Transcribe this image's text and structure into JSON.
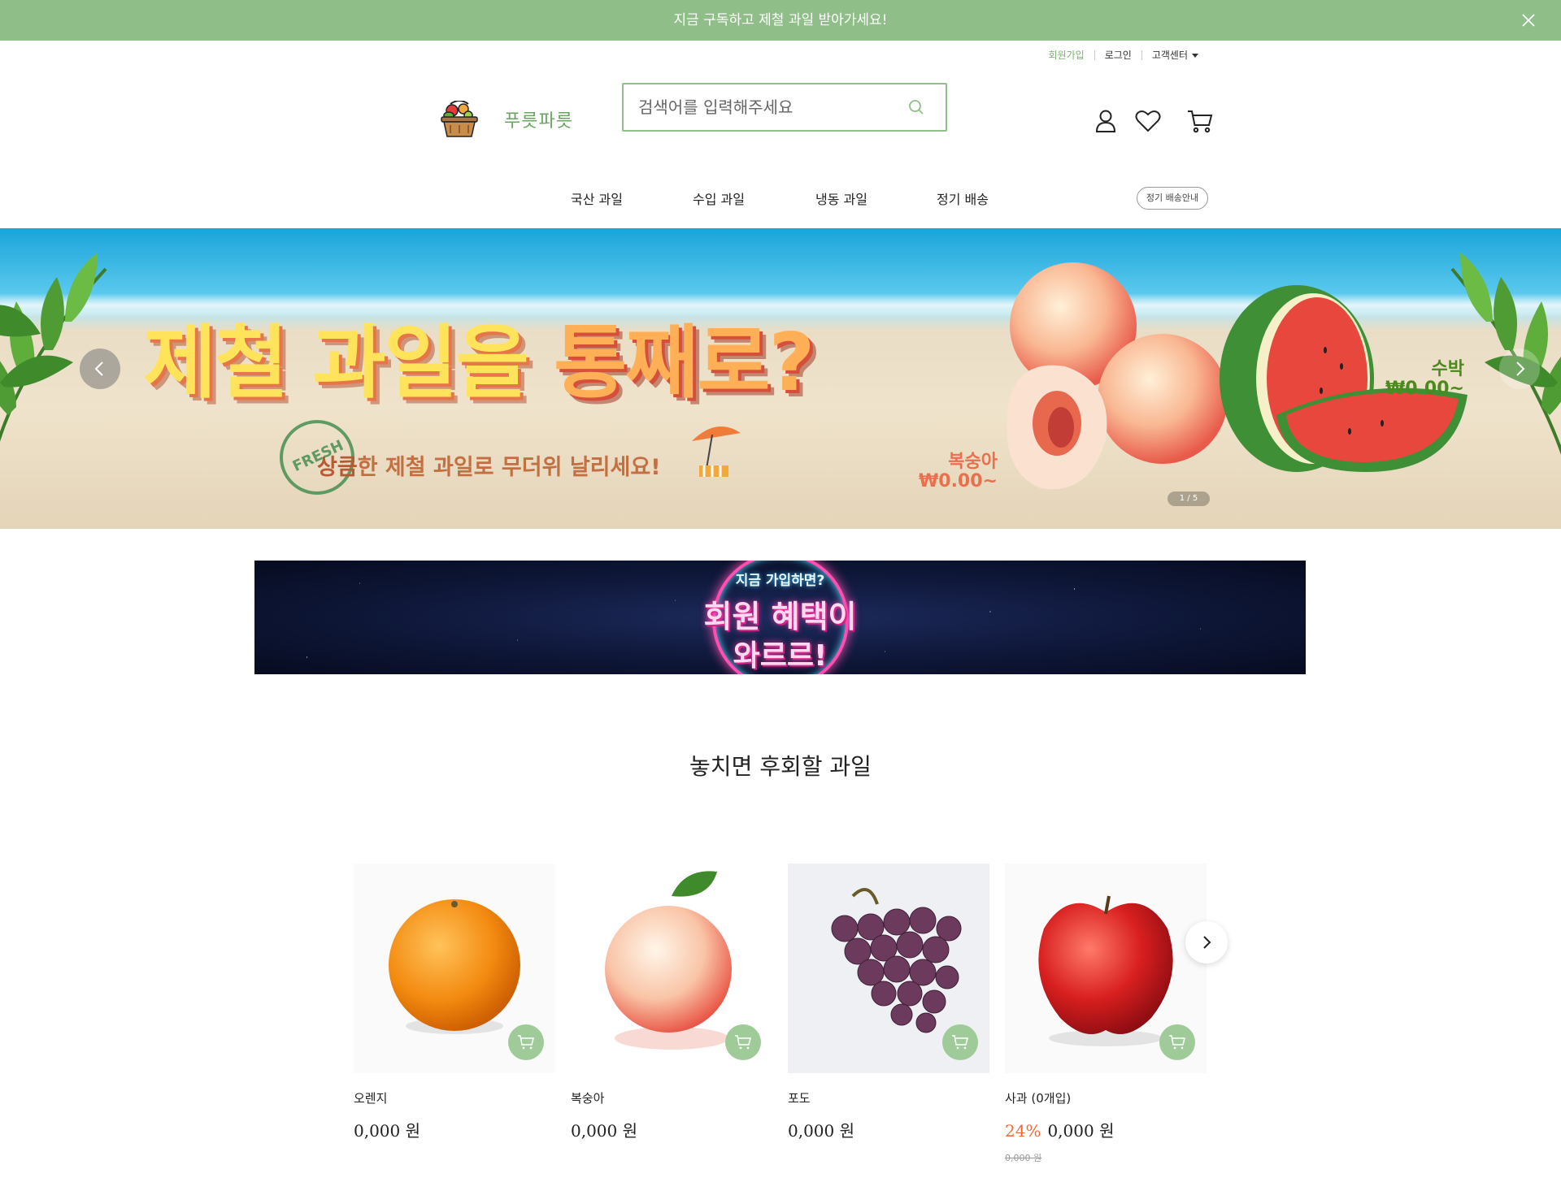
{
  "announcement": {
    "text": "지금 구독하고 제철 과일 받아가세요!"
  },
  "util_links": {
    "signup": "회원가입",
    "login": "로그인",
    "support": "고객센터"
  },
  "brand": {
    "name": "푸릇파릇"
  },
  "search": {
    "placeholder": "검색어를 입력해주세요"
  },
  "header_icons": [
    "user-icon",
    "heart-icon",
    "cart-icon"
  ],
  "nav": {
    "items": [
      "국산 과일",
      "수입 과일",
      "냉동 과일",
      "정기 배송"
    ],
    "pill": "정기 배송안내"
  },
  "hero": {
    "title_a": "제철 과일을 ",
    "title_b": "통째로?",
    "sub_a": "상큼",
    "sub_b": "한 제철 과일로 무더위 날리세요!",
    "stamp": "FRESH",
    "peach_name": "복숭아",
    "peach_price": "₩0.00~",
    "melon_name": "수박",
    "melon_price": "₩0.00~",
    "pager": "1 / 5"
  },
  "promo": {
    "line1": "지금 가입하면?",
    "line2": "회원 혜택이",
    "line3": "와르르!"
  },
  "section": {
    "title": "놓치면 후회할 과일"
  },
  "products": [
    {
      "name": "오렌지",
      "price": "0,000 원"
    },
    {
      "name": "복숭아",
      "price": "0,000 원"
    },
    {
      "name": "포도",
      "price": "0,000 원"
    },
    {
      "name": "사과 (0개입)",
      "discount": "24%",
      "price": "0,000 원",
      "original": "0,000 원"
    }
  ],
  "colors": {
    "brand_green": "#8fbe88",
    "accent_orange": "#ec6a3a"
  }
}
